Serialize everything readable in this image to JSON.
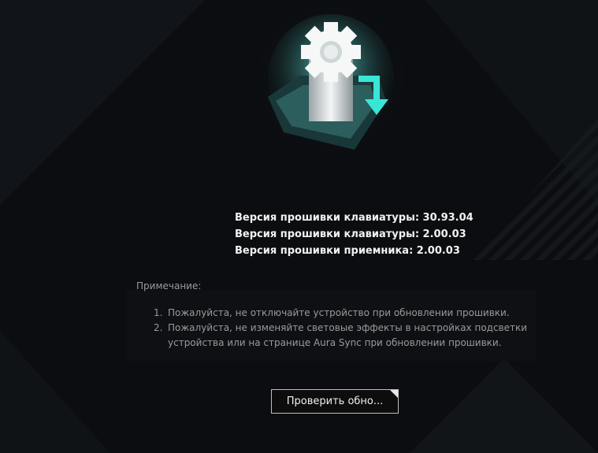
{
  "versions": {
    "keyboard_1": "Версия прошивки клавиатуры: 30.93.04",
    "keyboard_2": "Версия прошивки клавиатуры: 2.00.03",
    "receiver": "Версия прошивки приемника: 2.00.03"
  },
  "note": {
    "title": "Примечание:",
    "items": [
      {
        "num": "1.",
        "text": "Пожалуйста, не отключайте устройство при обновлении прошивки."
      },
      {
        "num": "2.",
        "text": "Пожалуйста, не изменяйте световые эффекты в настройках подсветки устройства или на странице Aura Sync при обновлении прошивки."
      }
    ]
  },
  "check_button": {
    "label": "Проверить обно..."
  },
  "icons": {
    "illustration": "firmware-update-gear-icon"
  },
  "colors": {
    "background": "#0b0d10",
    "accent_glow": "#35e0d4",
    "text": "#f2f2f2",
    "muted": "#9a9a9a"
  }
}
